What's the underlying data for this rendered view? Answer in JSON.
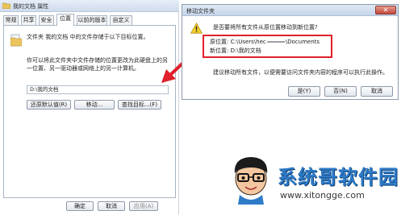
{
  "properties": {
    "title": "我的文档 属性",
    "tabs": [
      {
        "label": "常规"
      },
      {
        "label": "共享"
      },
      {
        "label": "安全"
      },
      {
        "label": "位置",
        "active": true
      },
      {
        "label": "以前的版本"
      },
      {
        "label": "自定义"
      }
    ],
    "description1": "文件夹 我的文档 中的文件存储于以下目标位置。",
    "description2": "你可以将此文件夹中文件存储的位置更改为此硬盘上的另一位置、另一驱动器或网络上的另一计算机。",
    "path_value": "D:\\我的文档",
    "buttons": {
      "restore": "还原默认值(R)",
      "move": "移动...",
      "find_target": "查找目标...(F)"
    },
    "footer": {
      "ok": "确定",
      "cancel": "取消",
      "apply": "应用(A)"
    }
  },
  "move_dialog": {
    "title": "移动文件夹",
    "close_glyph": "✕",
    "question": "是否要将所有文件从原位置移动到新位置?",
    "old_location_label": "原位置:",
    "old_location_prefix": "C:\\Users\\hec",
    "old_location_suffix": "\\Documents",
    "new_location_label": "新位置:",
    "new_location_value": "D:\\我的文档",
    "advice": "建议移动所有文件，以便需要访问文件夹内容的程序可以执行此操作。",
    "buttons": {
      "yes": "是(Y)",
      "no": "否(N)",
      "cancel": "取消"
    }
  },
  "watermark": {
    "name": "系统哥软件园",
    "url": "www.xitongge.com"
  },
  "colors": {
    "highlight": "#e0202a",
    "arrow": "#e0202a",
    "watermark_text": "#2e7bc8"
  },
  "icons": [
    "app-folder-icon",
    "folder-icon",
    "warning-icon",
    "close-icon",
    "arrow-icon",
    "mascot-logo"
  ]
}
